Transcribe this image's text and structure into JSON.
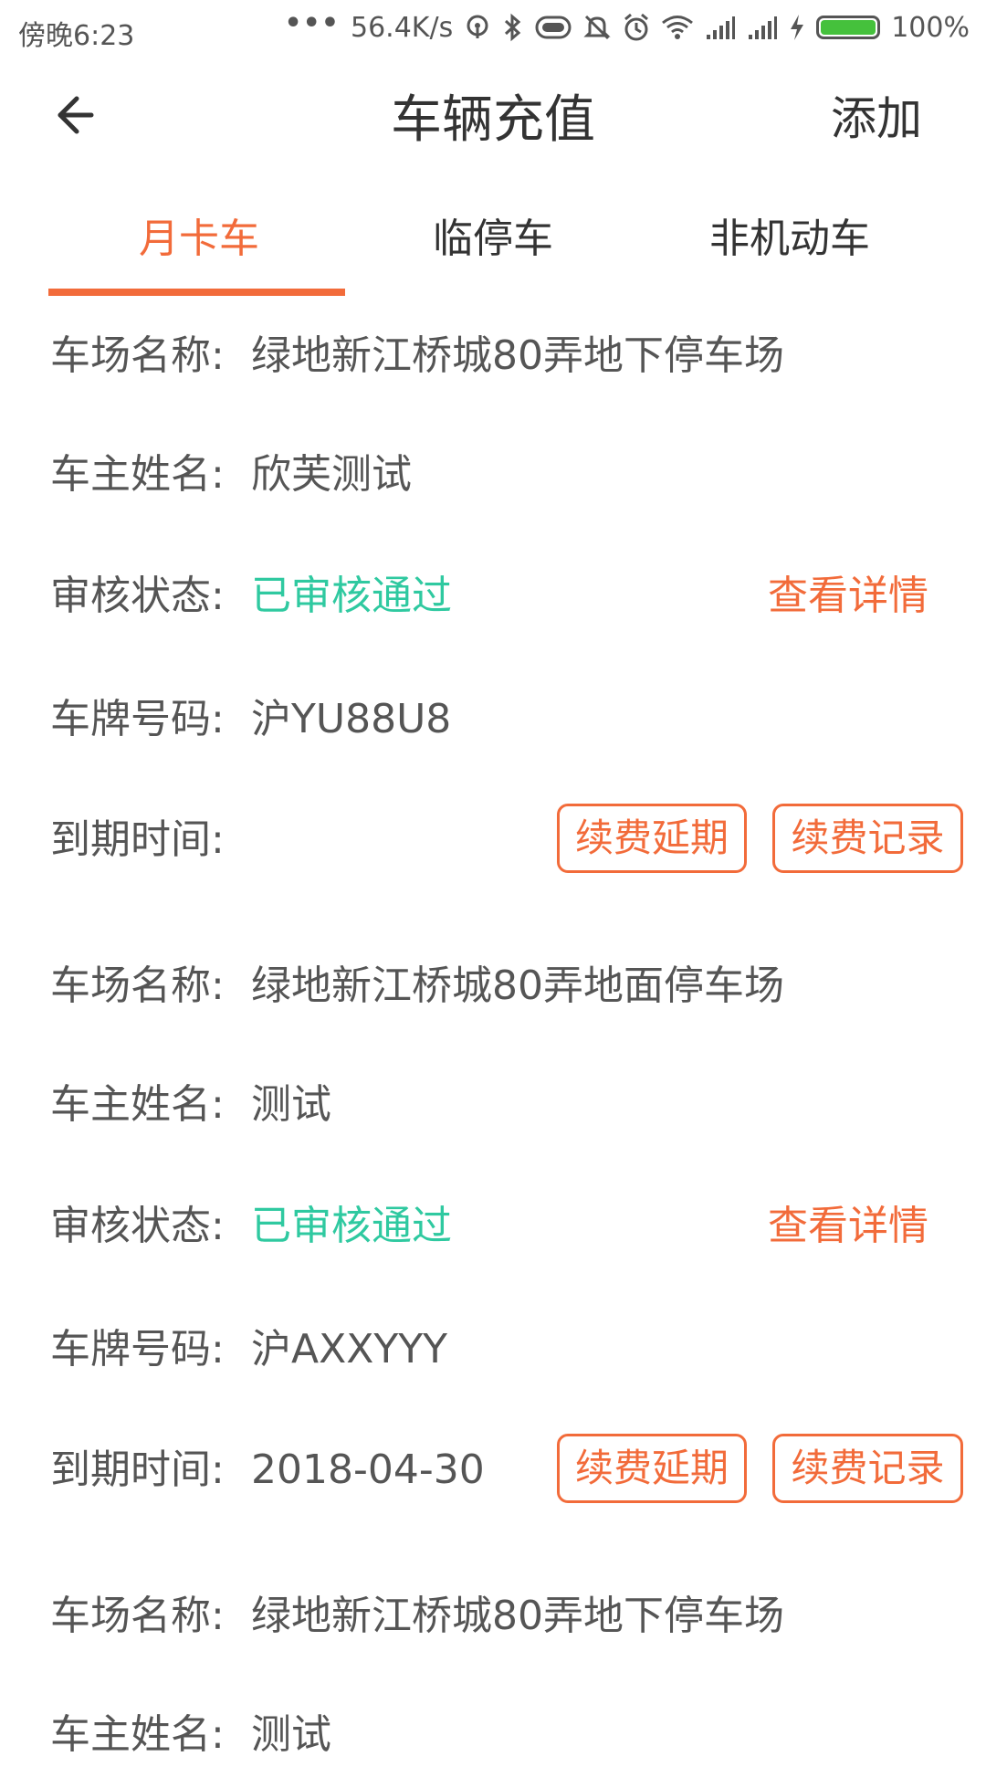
{
  "status_bar": {
    "time": "傍晚6:23",
    "dots": "•••",
    "speed": "56.4K/s",
    "battery_level": 1.0,
    "battery_pct": "100%",
    "battery_color": "#45c13c",
    "icons": [
      "hotspot-icon",
      "bluetooth-icon",
      "toggle-icon",
      "mute-icon",
      "alarm-icon",
      "wifi-icon",
      "signal-icon",
      "signal-icon",
      "charging-icon"
    ]
  },
  "header": {
    "title": "车辆充值",
    "add_label": "添加",
    "back_icon": "arrow-left-icon"
  },
  "tabs": [
    {
      "label": "月卡车",
      "active": true
    },
    {
      "label": "临停车",
      "active": false
    },
    {
      "label": "非机动车",
      "active": false
    }
  ],
  "labels": {
    "lot": "车场名称:",
    "owner": "车主姓名:",
    "status": "审核状态:",
    "plate": "车牌号码:",
    "expiry": "到期时间:"
  },
  "actions": {
    "detail": "查看详情",
    "renew": "续费延期",
    "records": "续费记录"
  },
  "records": [
    {
      "lot": "绿地新江桥城80弄地下停车场",
      "owner": "欣芙测试",
      "status": "已审核通过",
      "plate": "沪YU88U8",
      "expiry": ""
    },
    {
      "lot": "绿地新江桥城80弄地面停车场",
      "owner": "测试",
      "status": "已审核通过",
      "plate": "沪AXXYYY",
      "expiry": "2018-04-30"
    },
    {
      "lot": "绿地新江桥城80弄地下停车场",
      "owner": "测试"
    }
  ],
  "colors": {
    "accent": "#f26b3a",
    "status_ok": "#2fc9a0",
    "text": "#555555"
  }
}
